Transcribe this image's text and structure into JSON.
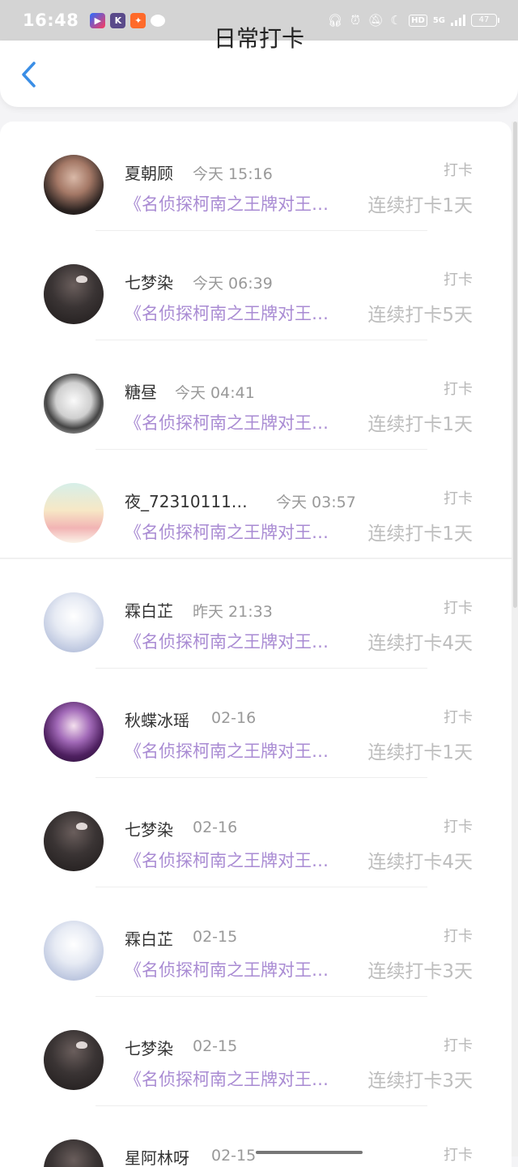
{
  "status_bar": {
    "time": "16:48",
    "app_icons": [
      "video-app-icon",
      "k-app-icon",
      "orange-app-icon",
      "chat-bubble-icon"
    ],
    "network": "5G",
    "hd_label": "HD",
    "battery": "47"
  },
  "header": {
    "title": "日常打卡",
    "back_icon": "chevron-left-icon"
  },
  "colors": {
    "accent_blue": "#3a8ee6",
    "book_purple": "#a98bd3",
    "muted_gray": "#bdbdbd"
  },
  "checkins": [
    {
      "user": "夏朝顾",
      "time": "今天  15:16",
      "tag": "打卡",
      "book": "《名侦探柯南之王牌对王…",
      "streak": "连续打卡1天"
    },
    {
      "user": "七梦染",
      "time": "今天  06:39",
      "tag": "打卡",
      "book": "《名侦探柯南之王牌对王…",
      "streak": "连续打卡5天"
    },
    {
      "user": "糖昼",
      "time": "今天  04:41",
      "tag": "打卡",
      "book": "《名侦探柯南之王牌对王…",
      "streak": "连续打卡1天"
    },
    {
      "user": "夜_72310111…",
      "time": "今天  03:57",
      "tag": "打卡",
      "book": "《名侦探柯南之王牌对王…",
      "streak": "连续打卡1天"
    },
    {
      "user": "霖白芷",
      "time": "昨天  21:33",
      "tag": "打卡",
      "book": "《名侦探柯南之王牌对王…",
      "streak": "连续打卡4天"
    },
    {
      "user": "秋蝶冰瑶",
      "time": "02-16",
      "tag": "打卡",
      "book": "《名侦探柯南之王牌对王…",
      "streak": "连续打卡1天"
    },
    {
      "user": "七梦染",
      "time": "02-16",
      "tag": "打卡",
      "book": "《名侦探柯南之王牌对王…",
      "streak": "连续打卡4天"
    },
    {
      "user": "霖白芷",
      "time": "02-15",
      "tag": "打卡",
      "book": "《名侦探柯南之王牌对王…",
      "streak": "连续打卡3天"
    },
    {
      "user": "七梦染",
      "time": "02-15",
      "tag": "打卡",
      "book": "《名侦探柯南之王牌对王…",
      "streak": "连续打卡3天"
    },
    {
      "user": "星阿林呀",
      "time": "02-15",
      "tag": "打卡",
      "book": "",
      "streak": ""
    }
  ]
}
